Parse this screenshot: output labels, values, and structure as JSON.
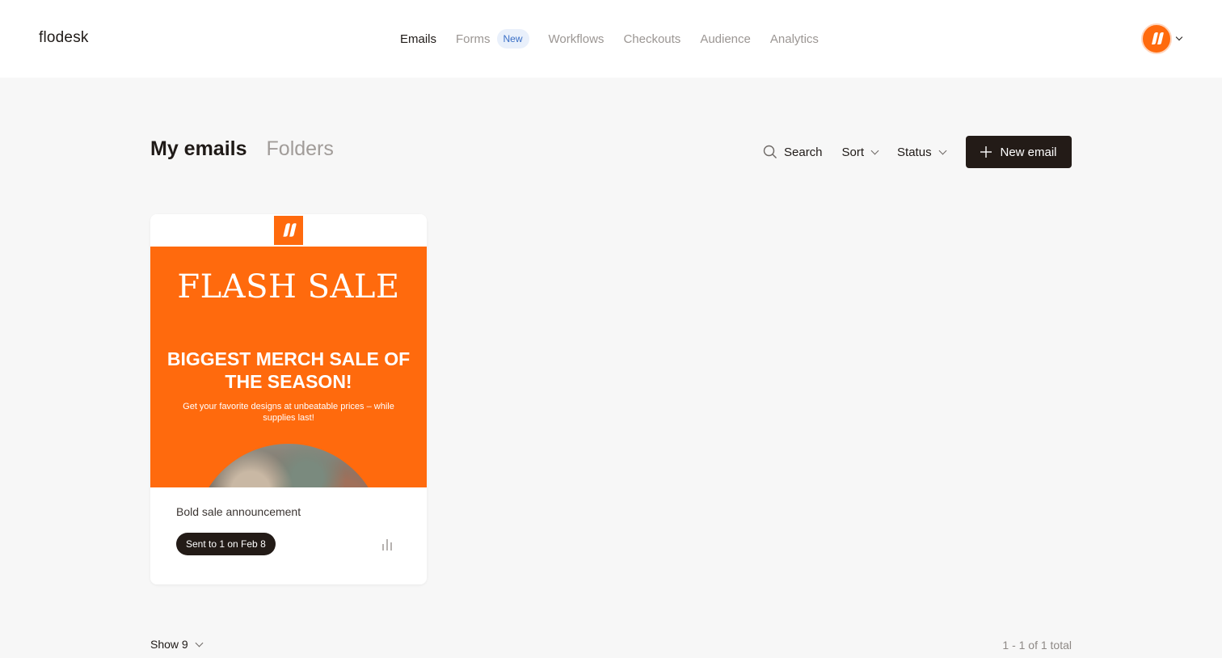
{
  "app": {
    "logo": "flodesk"
  },
  "nav": {
    "items": [
      {
        "label": "Emails"
      },
      {
        "label": "Forms",
        "badge": "New"
      },
      {
        "label": "Workflows"
      },
      {
        "label": "Checkouts"
      },
      {
        "label": "Audience"
      },
      {
        "label": "Analytics"
      }
    ]
  },
  "toolbar": {
    "title": "My emails",
    "tab_folders": "Folders",
    "search_label": "Search",
    "sort_label": "Sort",
    "status_label": "Status",
    "new_email_label": "New email"
  },
  "emails": [
    {
      "preview_headline": "FLASH SALE",
      "preview_subheadline": "BIGGEST MERCH SALE OF THE SEASON!",
      "preview_body": "Get your favorite designs at unbeatable prices – while supplies last!",
      "title": "Bold sale announcement",
      "status": "Sent to 1 on Feb 8"
    }
  ],
  "footer": {
    "show_label": "Show 9",
    "total_label": "1 - 1 of 1 total"
  },
  "colors": {
    "brand_orange": "#ff6a0d",
    "dark": "#231b17",
    "background": "#f7f7f7",
    "muted": "#9b9693"
  },
  "icons": [
    "brand-logo-icon",
    "search-icon",
    "chevron-down-icon",
    "plus-icon",
    "bar-chart-icon"
  ]
}
